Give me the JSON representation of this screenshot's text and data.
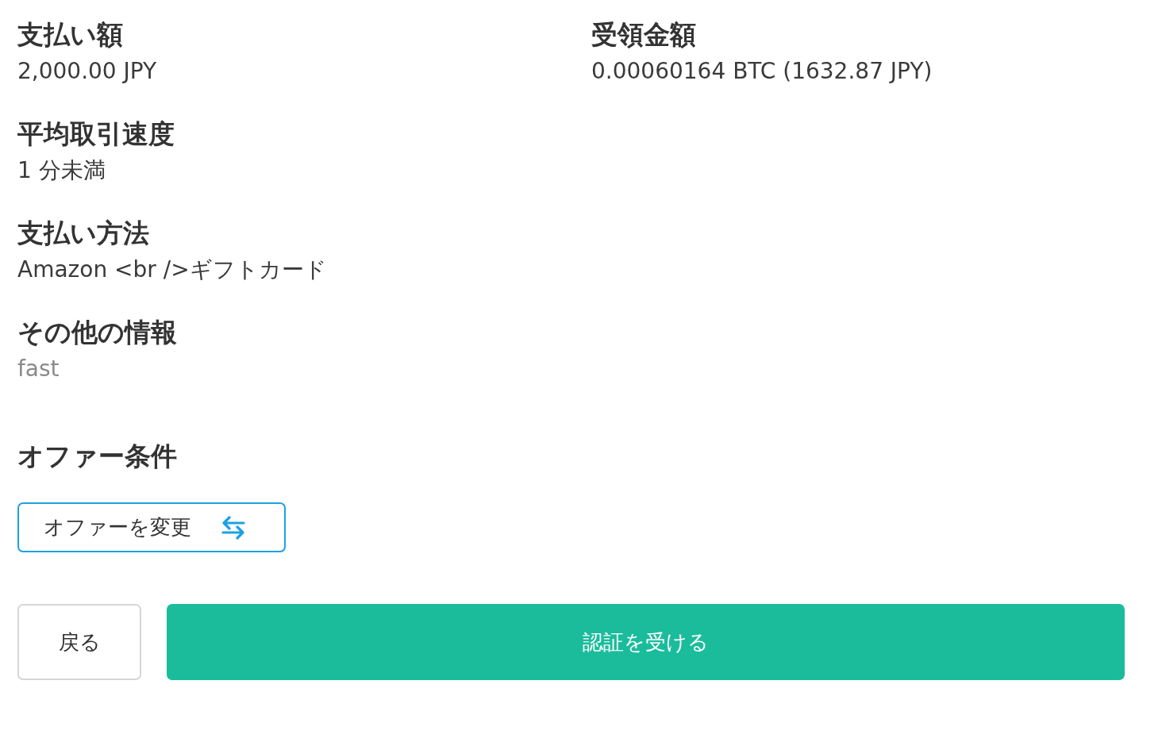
{
  "details": [
    [
      {
        "label": "支払い額",
        "value": "2,000.00 JPY",
        "kind": "plain"
      },
      {
        "label": "受領金額",
        "value": "0.00060164 BTC (1632.87 JPY)",
        "kind": "plain"
      }
    ],
    [
      {
        "label": "平均取引速度",
        "value": "1 分未満",
        "kind": "plain"
      }
    ],
    [
      {
        "label": "支払い方法",
        "value": "Amazon <br />ギフトカード",
        "kind": "plain"
      }
    ],
    [
      {
        "label": "その他の情報",
        "value": "fast",
        "kind": "note"
      }
    ]
  ],
  "offer_terms": {
    "title": "オファー条件",
    "change_button": "オファーを変更"
  },
  "actions": [
    {
      "label": "戻る",
      "kind": "secondary"
    },
    {
      "label": "認証を受ける",
      "kind": "primary"
    }
  ]
}
